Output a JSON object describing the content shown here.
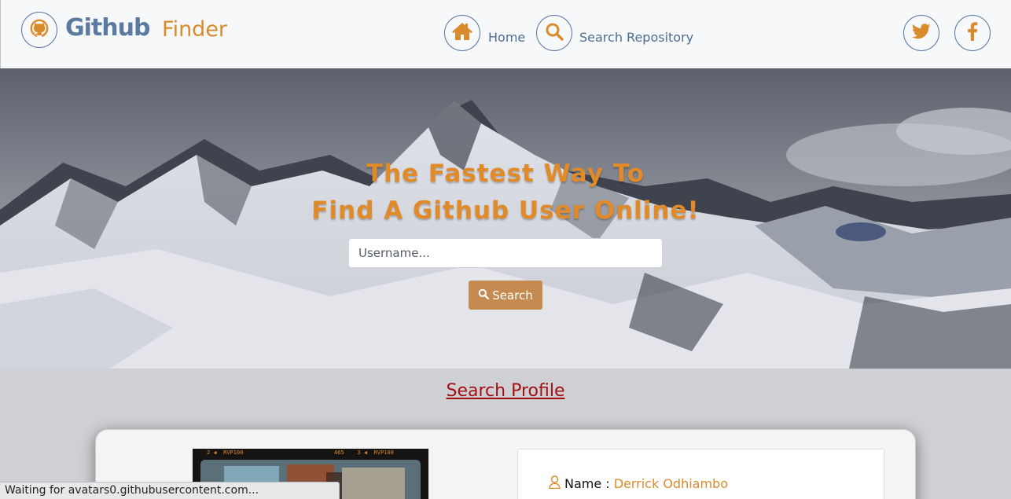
{
  "navbar": {
    "brand": {
      "primary": "Github",
      "secondary": "Finder"
    },
    "links": [
      {
        "label": "Home",
        "icon": "home-icon"
      },
      {
        "label": "Search Repository",
        "icon": "search-icon"
      }
    ],
    "social": [
      {
        "icon": "twitter-icon"
      },
      {
        "icon": "facebook-icon"
      }
    ]
  },
  "hero": {
    "headline_line1": "The Fastest Way To",
    "headline_line2": "Find A Github User Online!",
    "search_placeholder": "Username...",
    "search_button": "Search"
  },
  "profile_section": {
    "title": "Search Profile",
    "avatar_strip": {
      "left_marks": "2 ◀  RVP100",
      "right_marks": "465    3 ◀  RVP100"
    },
    "name_label": "Name :",
    "name_value": "Derrick Odhiambo"
  },
  "status_bar": {
    "text": "Waiting for avatars0.githubusercontent.com..."
  },
  "colors": {
    "accent_orange": "#d98b2b",
    "brand_blue": "#5b7aa0",
    "section_title_red": "#a30f12",
    "button_tan": "#c58a4f"
  }
}
